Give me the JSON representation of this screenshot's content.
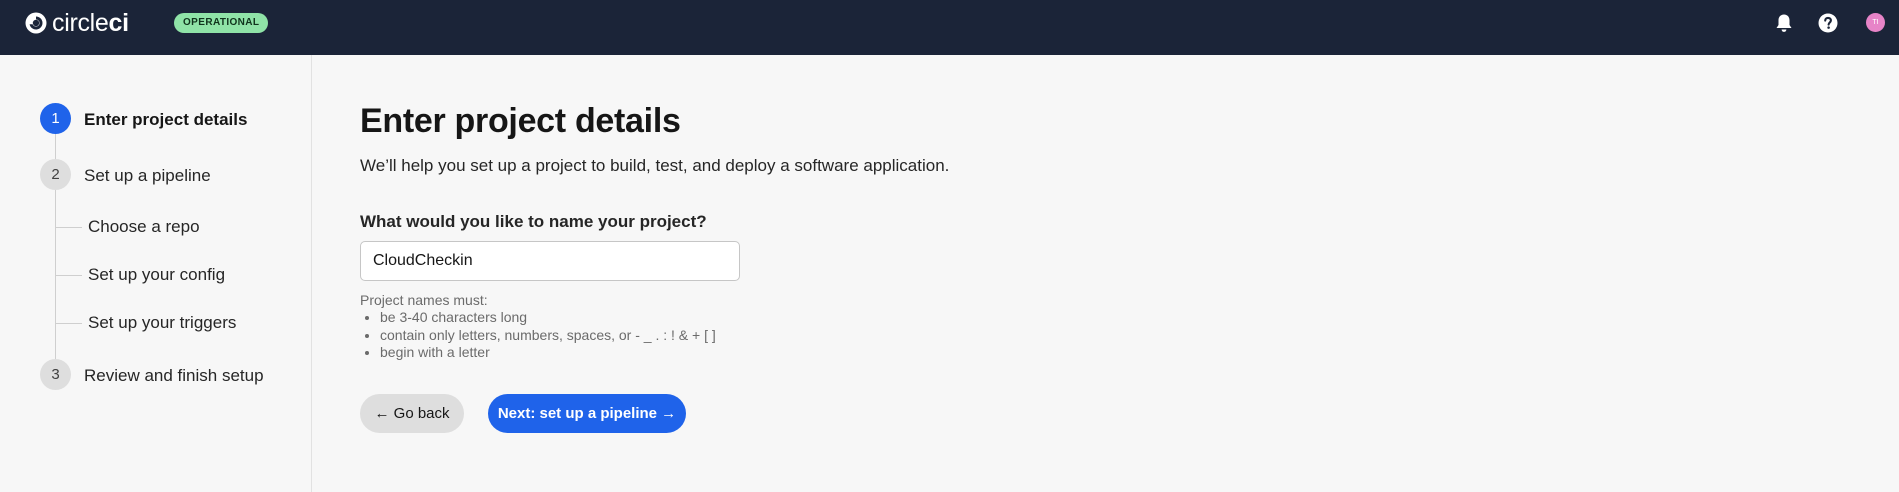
{
  "header": {
    "logo_text_light": "circle",
    "logo_text_bold": "ci",
    "status_badge": "OPERATIONAL",
    "avatar_initials": "TI"
  },
  "steps": [
    {
      "number": "1",
      "label": "Enter project details",
      "active": true
    },
    {
      "number": "2",
      "label": "Set up a pipeline",
      "active": false
    },
    {
      "number": "3",
      "label": "Review and finish setup",
      "active": false
    }
  ],
  "substeps": [
    {
      "label": "Choose a repo"
    },
    {
      "label": "Set up your config"
    },
    {
      "label": "Set up your triggers"
    }
  ],
  "main": {
    "title": "Enter project details",
    "subtitle": "We’ll help you set up a project to build, test, and deploy a software application.",
    "field_label": "What would you like to name your project?",
    "project_name_value": "CloudCheckin",
    "rules_title": "Project names must:",
    "rules": [
      "be 3-40 characters long",
      "contain only letters, numbers, spaces, or - _ . : ! & + [ ]",
      "begin with a letter"
    ],
    "back_button": "← Go back",
    "next_button": "Next: set up a pipeline →"
  },
  "colors": {
    "header_bg": "#1b2438",
    "accent": "#1f63ea",
    "status_green": "#8fe3a7",
    "avatar": "#e784c8"
  },
  "icons": [
    "circleci-logo-icon",
    "bell-icon",
    "help-icon"
  ]
}
